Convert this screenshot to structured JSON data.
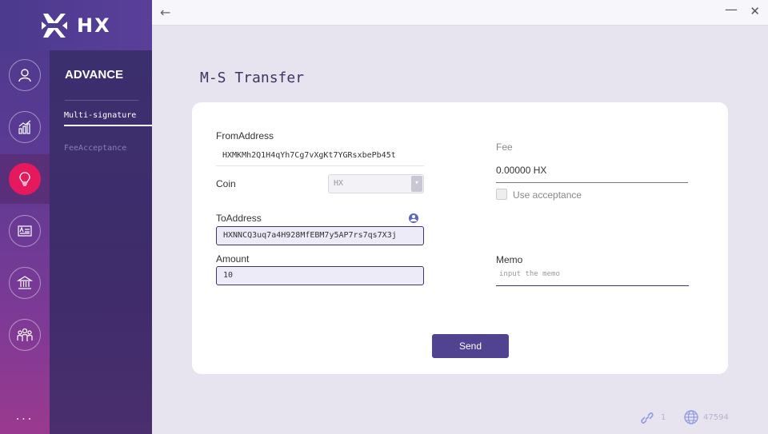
{
  "app": {
    "logo_text": "HX"
  },
  "titlebar": {
    "back_icon": "←",
    "minimize_icon": "—",
    "close_icon": "✕"
  },
  "sidebar": {
    "items": [
      {
        "name": "account"
      },
      {
        "name": "chart"
      },
      {
        "name": "advance",
        "active": true
      },
      {
        "name": "contacts"
      },
      {
        "name": "bank"
      },
      {
        "name": "group"
      }
    ],
    "more": "..."
  },
  "submenu": {
    "title": "ADVANCE",
    "items": [
      "Multi-signature",
      "FeeAcceptance"
    ],
    "selected": "Multi-signature"
  },
  "page": {
    "title": "M-S Transfer"
  },
  "form": {
    "from_label": "FromAddress",
    "from_value": "HXMKMh2Q1H4qYh7Cg7vXgKt7YGRsxbePb45t",
    "coin_label": "Coin",
    "coin_value": "HX",
    "to_label": "ToAddress",
    "to_value": "HXNNCQ3uq7a4H928MfEBM7y5AP7rs7qs7X3j",
    "amount_label": "Amount",
    "amount_value": "10",
    "fee_label": "Fee",
    "fee_value": "0.00000 HX",
    "use_acceptance_label": "Use acceptance",
    "memo_label": "Memo",
    "memo_placeholder": "input the memo",
    "send_label": "Send"
  },
  "status": {
    "connections": "1",
    "block_height": "47594"
  },
  "colors": {
    "accent": "#514390",
    "active": "#e6195f"
  }
}
